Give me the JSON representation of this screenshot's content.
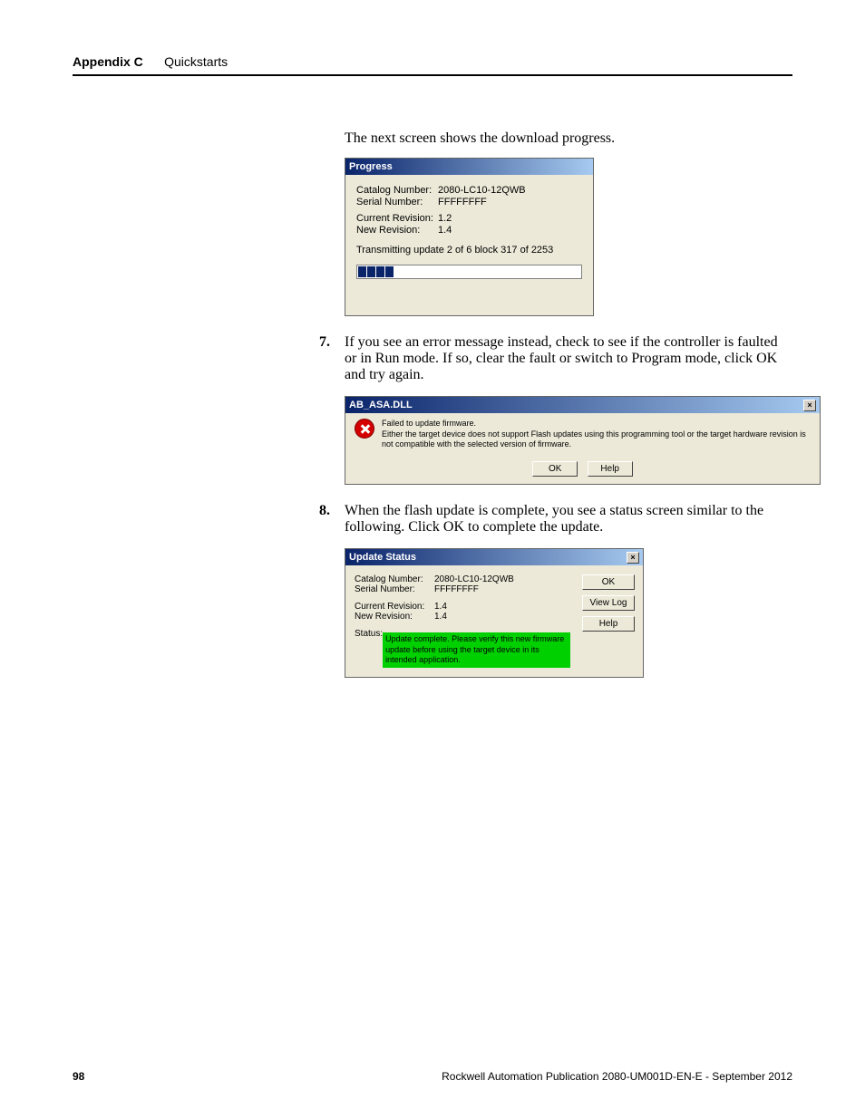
{
  "header": {
    "appendix": "Appendix C",
    "section": "Quickstarts"
  },
  "intro": "The next screen shows the download progress.",
  "progress": {
    "title": "Progress",
    "catalog_k": "Catalog Number:",
    "catalog_v": "2080-LC10-12QWB",
    "serial_k": "Serial Number:",
    "serial_v": "FFFFFFFF",
    "currev_k": "Current Revision:",
    "currev_v": "1.2",
    "newrev_k": "New Revision:",
    "newrev_v": "1.4",
    "status": "Transmitting update 2 of 6  block 317 of 2253"
  },
  "step7": {
    "num": "7.",
    "text": "If you see an error message instead, check to see if the controller is faulted or in Run mode.  If so, clear the fault or switch to Program mode, click OK and try again."
  },
  "error": {
    "title": "AB_ASA.DLL",
    "line1": "Failed to update firmware.",
    "line2": "Either the target device does not support Flash updates using this programming tool or the target hardware revision is not compatible with the selected version of firmware.",
    "ok": "OK",
    "help": "Help"
  },
  "step8": {
    "num": "8.",
    "text": "When the flash update is complete, you see a status screen similar to the following.  Click OK to complete the update."
  },
  "status": {
    "title": "Update Status",
    "catalog_k": "Catalog Number:",
    "catalog_v": "2080-LC10-12QWB",
    "serial_k": "Serial Number:",
    "serial_v": "FFFFFFFF",
    "currev_k": "Current Revision:",
    "currev_v": "1.4",
    "newrev_k": "New Revision:",
    "newrev_v": "1.4",
    "status_k": "Status:",
    "status_msg": "Update complete. Please verify this new firmware update before using the target device in its intended application.",
    "ok": "OK",
    "viewlog": "View Log",
    "help": "Help"
  },
  "footer": {
    "page": "98",
    "pub": "Rockwell Automation Publication 2080-UM001D-EN-E - September 2012"
  }
}
